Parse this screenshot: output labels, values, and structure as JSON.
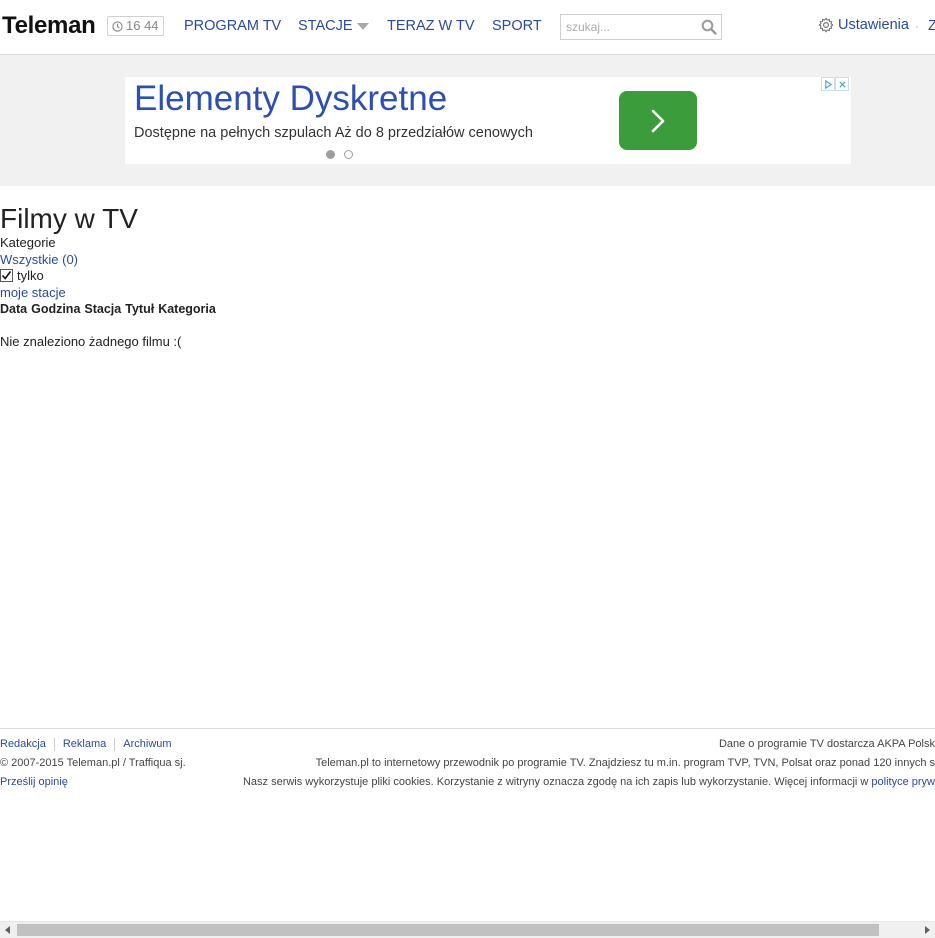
{
  "header": {
    "logo": "Teleman",
    "clock_time": "16 44",
    "nav": {
      "program": "PROGRAM TV",
      "stacje": "STACJE",
      "teraz": "TERAZ W TV",
      "sport": "SPORT"
    },
    "search_placeholder": "szukaj...",
    "settings_label": "Ustawienia",
    "separator": "·",
    "cut_link": "Z"
  },
  "ad": {
    "title": "Elementy Dyskretne",
    "description": "Dostępne na pełnych szpulach Aż do 8 przedziałów cenowych",
    "button_color": "#3a9c3a"
  },
  "main": {
    "title": "Filmy w TV",
    "categories_label": "Kategorie",
    "all_link": "Wszystkie (0)",
    "only_label": "tylko",
    "only_checked": true,
    "my_stations_link": "moje stacje",
    "columns": [
      "Data",
      "Godzina",
      "Stacja",
      "Tytuł",
      "Kategoria"
    ],
    "empty_message": "Nie znaleziono żadnego filmu :("
  },
  "footer": {
    "links": [
      "Redakcja",
      "Reklama",
      "Archiwum"
    ],
    "copyright": "© 2007-2015 Teleman.pl / Traffiqua sj.",
    "feedback": "Prześlij opinię",
    "data_source": "Dane o programie TV dostarcza AKPA Polsk",
    "about": "Teleman.pl to internetowy przewodnik po programie TV. Znajdziesz tu m.in. program TVP, TVN, Polsat oraz ponad 120 innych s",
    "cookies": "Nasz serwis wykorzystuje pliki cookies. Korzystanie z witryny oznacza zgodę na ich zapis lub wykorzystanie. Więcej informacji w",
    "cookies_link": "polityce pryw"
  },
  "colors": {
    "link": "#2a4a9e",
    "ad_title": "#2b4fb3",
    "ad_band": "#f1f1f1"
  },
  "icons": [
    "clock-icon",
    "search-icon",
    "gear-icon",
    "chevron-right-icon",
    "adchoices-icon",
    "close-icon",
    "check-icon",
    "scroll-left-icon",
    "scroll-right-icon"
  ]
}
